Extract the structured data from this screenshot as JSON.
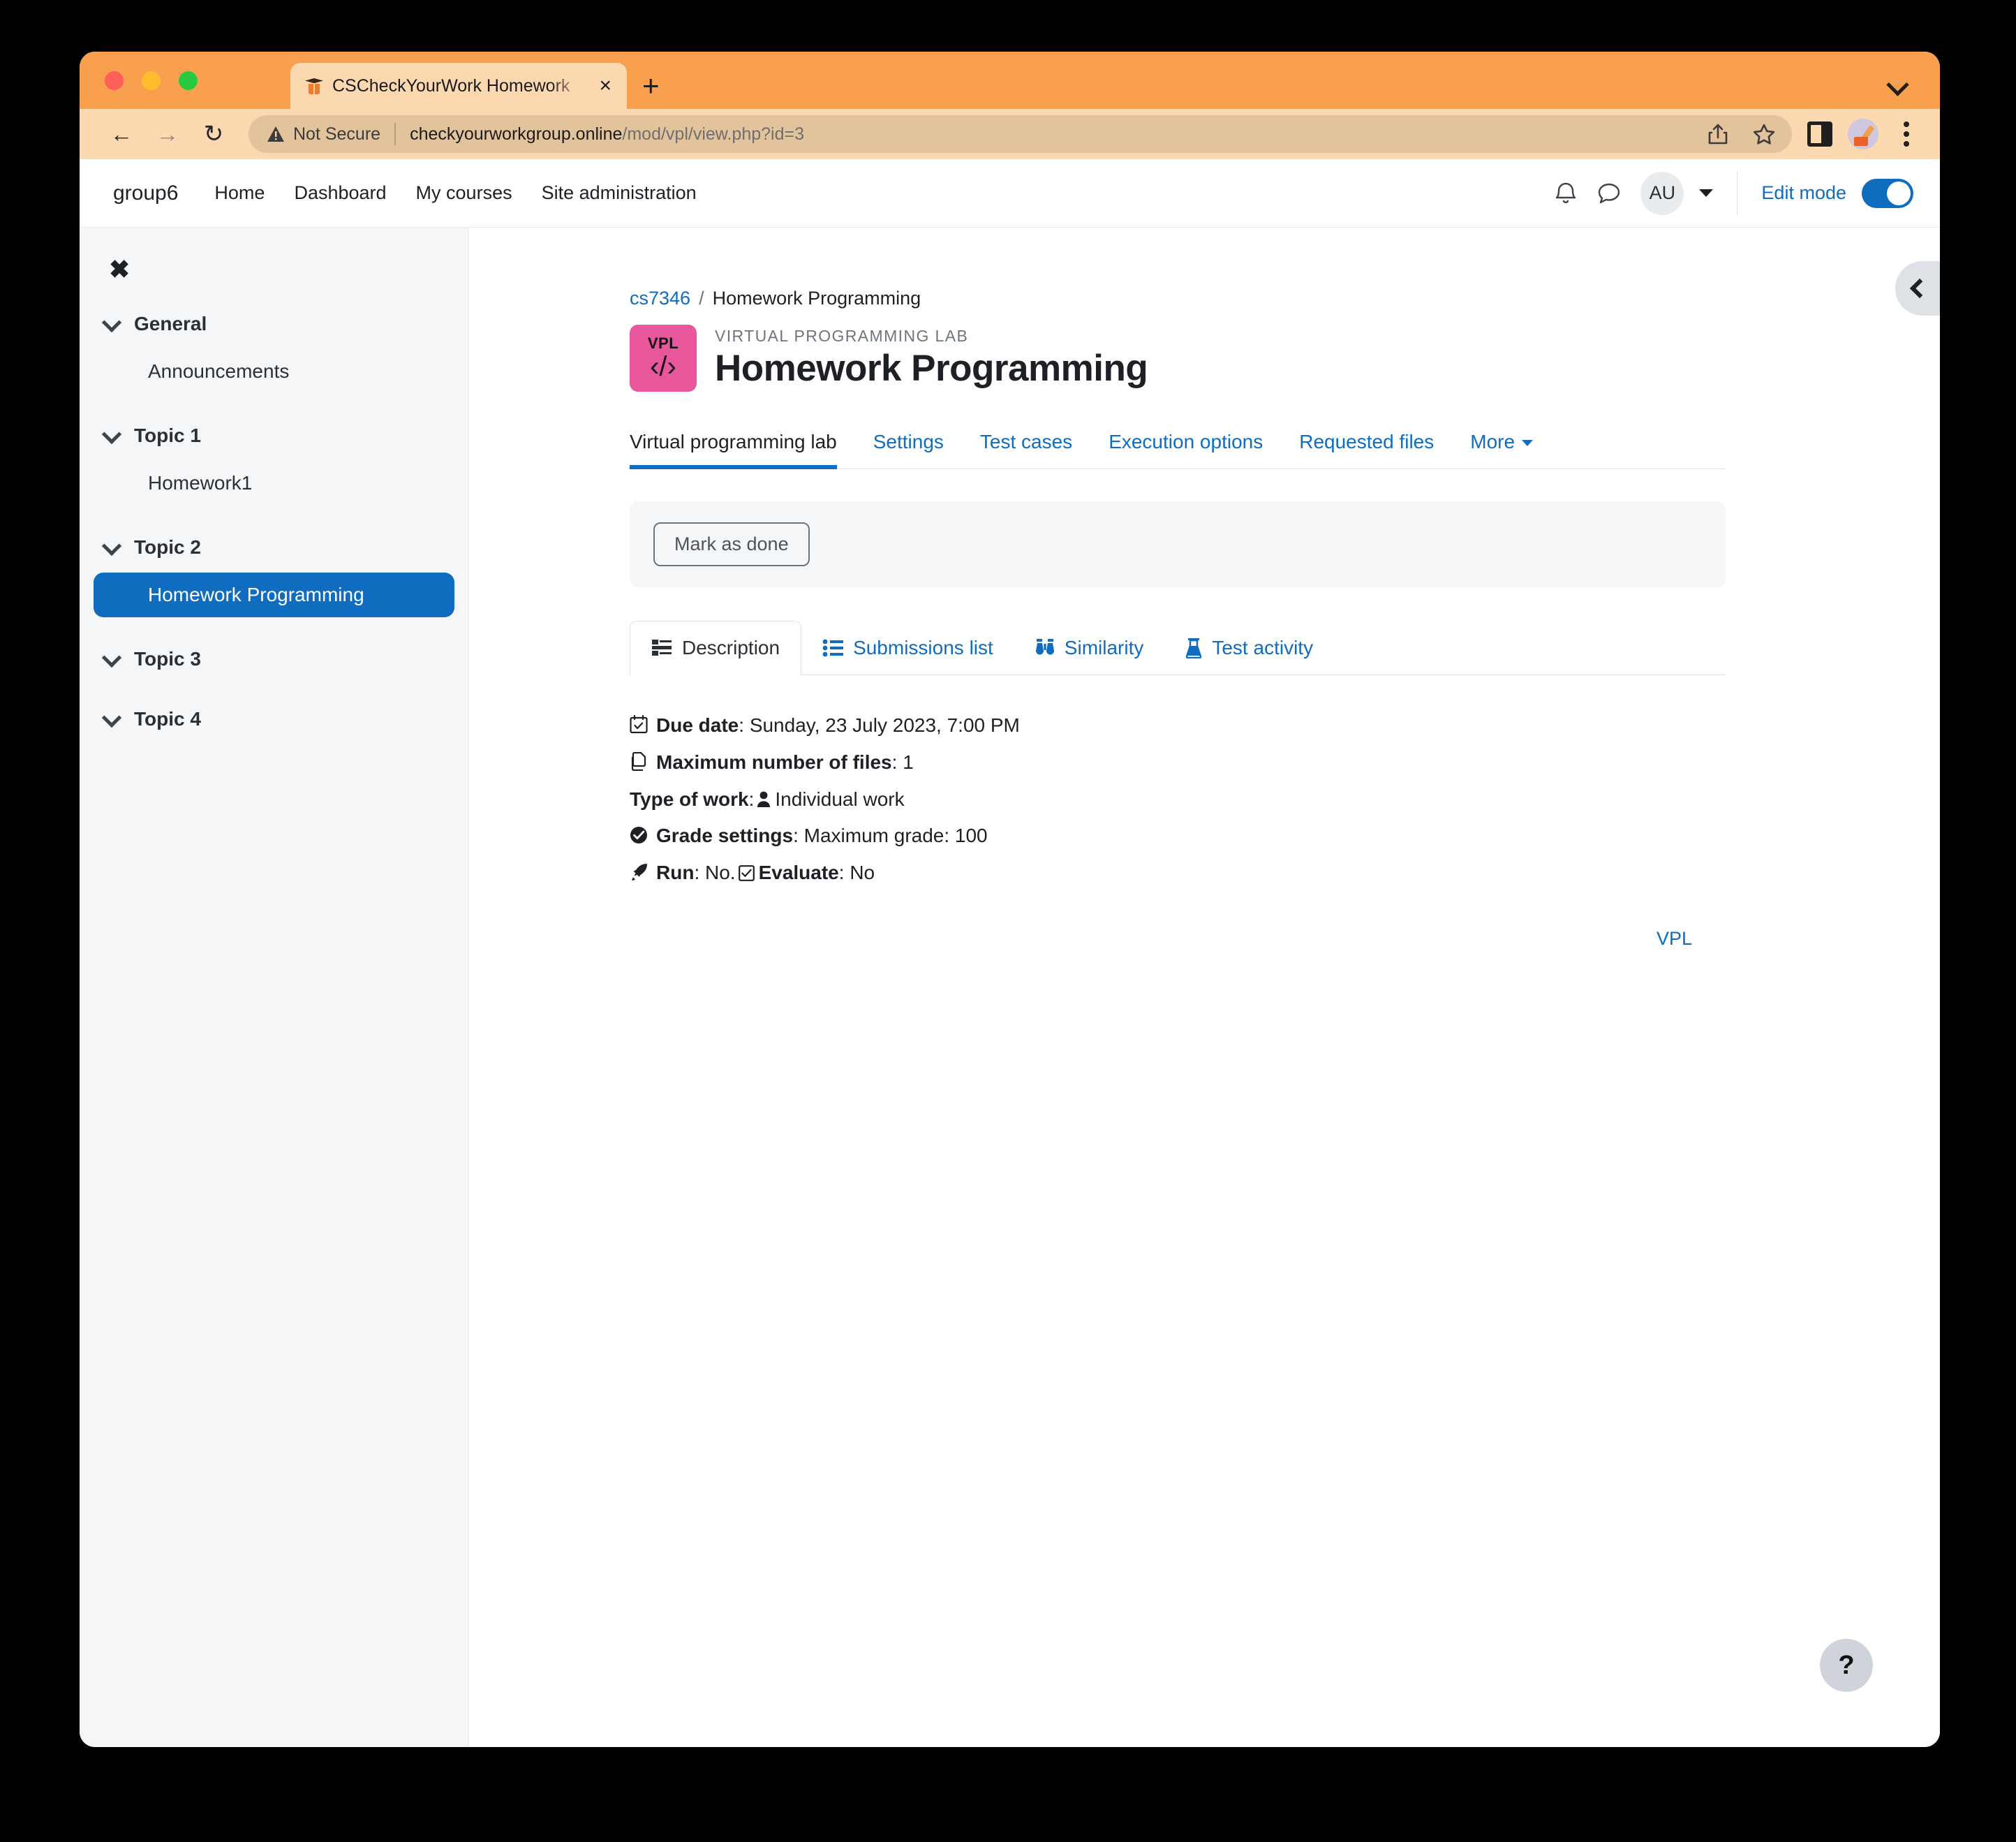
{
  "browser": {
    "tab": {
      "title": "CSCheckYourWork Homework",
      "favicon": "moodle-graduation-cap-icon",
      "close_label": "×"
    },
    "new_tab_label": "+",
    "back_label": "←",
    "forward_label": "→",
    "reload_label": "↻",
    "security_label": "Not Secure",
    "url_host": "checkyourworkgroup.online",
    "url_path": "/mod/vpl/view.php?id=3",
    "url_full": "checkyourworkgroup.online/mod/vpl/view.php?id=3"
  },
  "navbar": {
    "site_name": "group6",
    "links": [
      {
        "label": "Home"
      },
      {
        "label": "Dashboard"
      },
      {
        "label": "My courses"
      },
      {
        "label": "Site administration"
      }
    ],
    "user_initials": "AU",
    "edit_mode_label": "Edit mode",
    "edit_mode_on": true
  },
  "course_index": {
    "close_label": "✖",
    "sections": [
      {
        "title": "General",
        "items": [
          {
            "label": "Announcements",
            "active": false
          }
        ]
      },
      {
        "title": "Topic 1",
        "items": [
          {
            "label": "Homework1",
            "active": false
          }
        ]
      },
      {
        "title": "Topic 2",
        "items": [
          {
            "label": "Homework Programming",
            "active": true
          }
        ]
      },
      {
        "title": "Topic 3",
        "items": []
      },
      {
        "title": "Topic 4",
        "items": []
      }
    ]
  },
  "breadcrumb": {
    "course": "cs7346",
    "separator": "/",
    "current": "Homework Programming"
  },
  "header": {
    "icon_text": "VPL",
    "icon_code": "‹/›",
    "activity_type": "VIRTUAL PROGRAMMING LAB",
    "title": "Homework Programming",
    "icon_color": "#e8579c"
  },
  "primary_tabs": [
    {
      "label": "Virtual programming lab",
      "active": true
    },
    {
      "label": "Settings",
      "active": false
    },
    {
      "label": "Test cases",
      "active": false
    },
    {
      "label": "Execution options",
      "active": false
    },
    {
      "label": "Requested files",
      "active": false
    },
    {
      "label": "More",
      "active": false,
      "has_caret": true
    }
  ],
  "completion": {
    "button_label": "Mark as done"
  },
  "vpl_tabs": [
    {
      "label": "Description",
      "icon": "list-description-icon",
      "active": true
    },
    {
      "label": "Submissions list",
      "icon": "list-ul-icon",
      "active": false
    },
    {
      "label": "Similarity",
      "icon": "binoculars-icon",
      "active": false
    },
    {
      "label": "Test activity",
      "icon": "flask-icon",
      "active": false
    }
  ],
  "description": {
    "rows": [
      {
        "icon": "calendar-check-icon",
        "label": "Due date",
        "sep": ":",
        "value": "Sunday, 23 July 2023, 7:00 PM"
      },
      {
        "icon": "copy-files-icon",
        "label": "Maximum number of files",
        "sep": ":",
        "value": "1"
      },
      {
        "icon": "",
        "label": "Type of work",
        "sep": ":",
        "inline_icon": "user-icon",
        "value": "Individual work"
      },
      {
        "icon": "check-circle-icon",
        "label": "Grade settings",
        "sep": ":",
        "value": "Maximum grade: 100"
      },
      {
        "icon": "rocket-icon",
        "label": "Run",
        "sep": ":",
        "value": "No.",
        "label2": "Evaluate",
        "sep2": ":",
        "value2": "No",
        "inline_icon2": "check-square-icon"
      }
    ]
  },
  "footer": {
    "vpl_link": "VPL"
  },
  "help": {
    "label": "?"
  },
  "drawer_toggle": {
    "name": "block-drawer-toggle"
  }
}
